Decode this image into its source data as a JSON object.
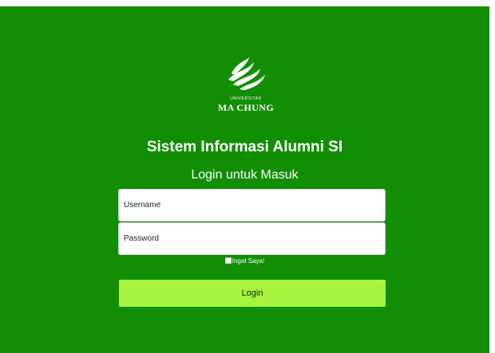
{
  "brand": {
    "university_small": "UNIVERSITAS",
    "university_name": "MA CHUNG"
  },
  "header": {
    "title": "Sistem Informasi Alumni SI",
    "subtitle": "Login untuk Masuk"
  },
  "form": {
    "username_placeholder": "Username",
    "password_placeholder": "Password",
    "remember_label": "Ingat Saya!",
    "login_label": "Login"
  },
  "colors": {
    "background": "#128e05",
    "button": "#a6f43d"
  }
}
